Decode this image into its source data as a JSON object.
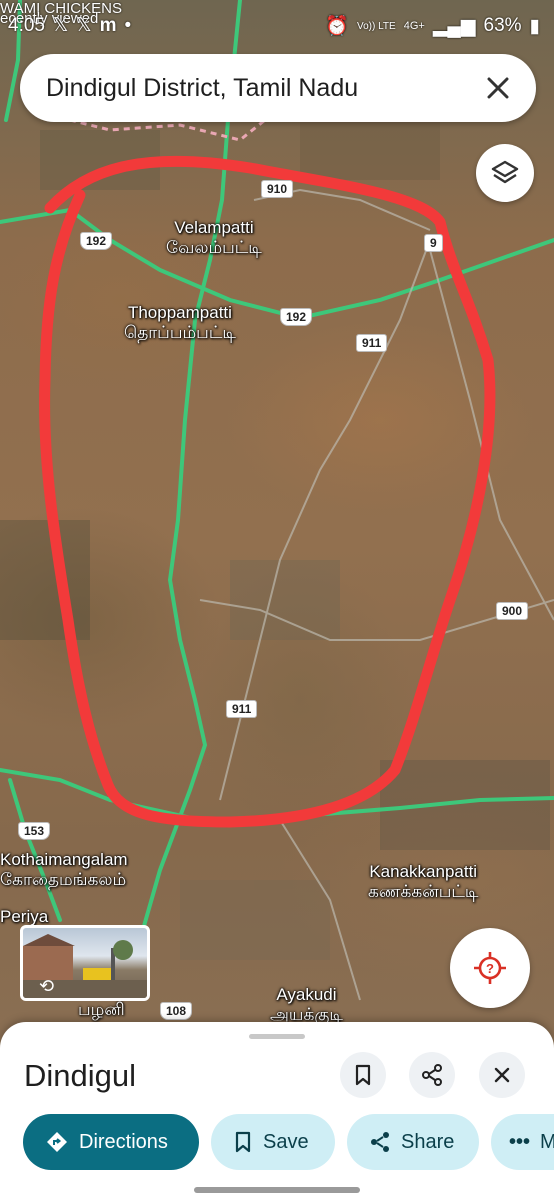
{
  "status_bar": {
    "time": "4:05",
    "notification_icons": [
      "x-icon",
      "x-icon",
      "m-icon",
      "dot-icon"
    ],
    "battery": "63%",
    "network": "4G+",
    "volte": "Vo)) LTE",
    "overlay_line1": "WAMI CHICKENS",
    "overlay_line2": "ecently viewed"
  },
  "search": {
    "query": "Dindigul District, Tamil Nadu"
  },
  "map": {
    "places": [
      {
        "id": "velampatti",
        "en": "Velampatti",
        "ta": "வேலம்பட்டி"
      },
      {
        "id": "thoppampatti",
        "en": "Thoppampatti",
        "ta": "தொப்பம்பட்டி"
      },
      {
        "id": "kothaimangalam",
        "en": "Kothaimangalam",
        "ta": "கோதைமங்கலம்"
      },
      {
        "id": "kanakkanpatti",
        "en": "Kanakkanpatti",
        "ta": "கணக்கன்பட்டி"
      },
      {
        "id": "ayakudi",
        "en": "Ayakudi",
        "ta": "அயக்குடி"
      },
      {
        "id": "periya",
        "en": "Periya",
        "ta": ""
      },
      {
        "id": "palani",
        "en": "",
        "ta": "பழனி"
      }
    ],
    "road_shields": [
      "910",
      "192",
      "192",
      "911",
      "911",
      "900",
      "153",
      "108",
      "9"
    ]
  },
  "sheet": {
    "title": "Dindigul",
    "actions": [
      {
        "id": "directions",
        "label": "Directions"
      },
      {
        "id": "save",
        "label": "Save"
      },
      {
        "id": "share",
        "label": "Share"
      },
      {
        "id": "more",
        "label": "M"
      }
    ]
  },
  "colors": {
    "primary_chip": "#0b6e82",
    "secondary_chip": "#cfeef5",
    "highlight_outline": "#f23a3a",
    "road": "#3ec77a"
  }
}
